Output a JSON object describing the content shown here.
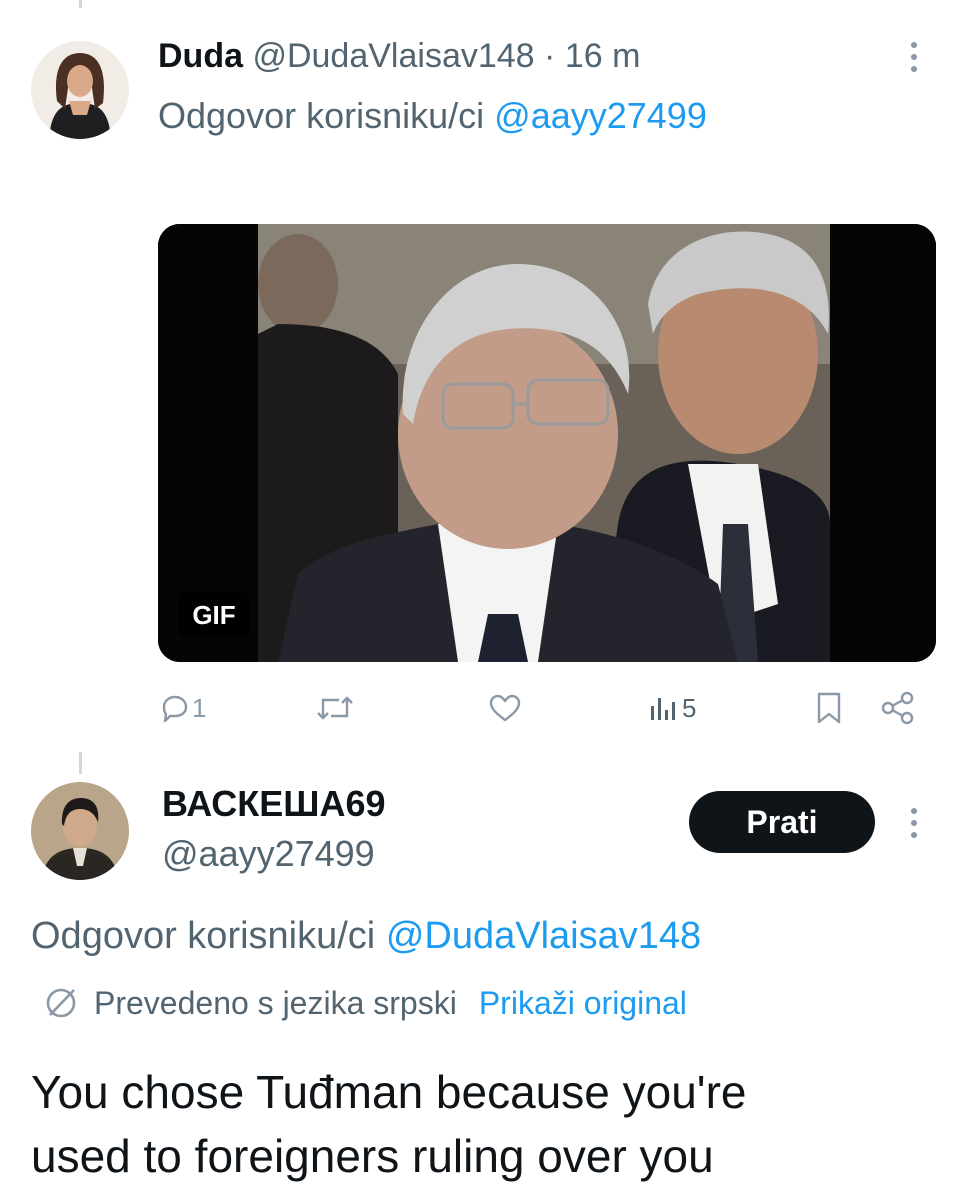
{
  "tweet1": {
    "display_name": "Duda",
    "handle": "@DudaVlaisav148",
    "separator": "·",
    "time": "16 m",
    "reply_prefix": "Odgovor korisniku/ci",
    "reply_handle": "@aayy27499",
    "media_badge": "GIF",
    "actions": {
      "reply_count": "1",
      "retweet_count": "",
      "like_count": "",
      "views_count": "5"
    }
  },
  "tweet2": {
    "display_name": "ВАСКЕША69",
    "handle": "@aayy27499",
    "follow_label": "Prati",
    "reply_prefix": "Odgovor korisniku/ci",
    "reply_handle": "@DudaVlaisav148",
    "translated_note": "Prevedeno s jezika srpski",
    "show_original": "Prikaži original",
    "text_line1": "You chose Tuđman because you're",
    "text_line2": "used to foreigners ruling over you"
  },
  "icons": [
    "more-vertical-icon",
    "reply-icon",
    "retweet-icon",
    "like-icon",
    "views-icon",
    "bookmark-icon",
    "share-icon",
    "translate-globe-icon"
  ],
  "colors": {
    "link": "#1d9bf0",
    "muted": "#536471",
    "icon": "#8b98a5",
    "button": "#0f1419"
  }
}
